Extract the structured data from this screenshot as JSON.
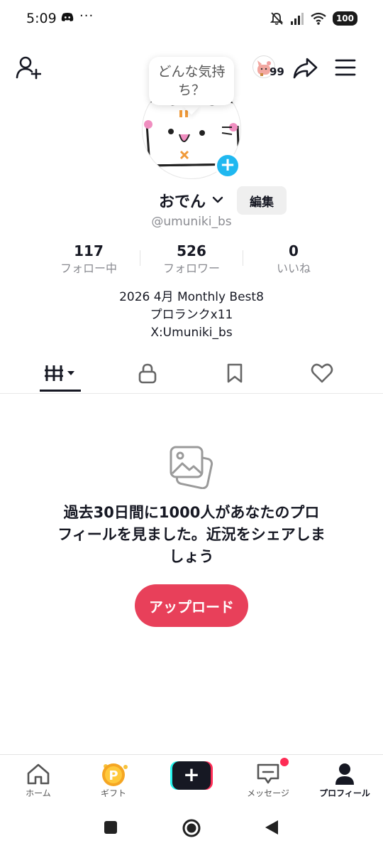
{
  "status_bar": {
    "time": "5:09",
    "dots": "···",
    "battery": "100"
  },
  "top_bar": {
    "bubble_text": "どんな気持ち？",
    "hearts_count": "99"
  },
  "profile": {
    "name": "おでん",
    "edit_label": "編集",
    "handle": "@umuniki_bs",
    "stats": [
      {
        "value": "117",
        "label": "フォロー中"
      },
      {
        "value": "526",
        "label": "フォロワー"
      },
      {
        "value": "0",
        "label": "いいね"
      }
    ],
    "bio": [
      "2026 4月 Monthly Best8",
      "プロランクx11",
      "X:Umuniki_bs"
    ]
  },
  "empty_state": {
    "message": "過去30日間に1000人があなたのプロフィールを見ました。近況をシェアしましょう",
    "upload_label": "アップロード"
  },
  "bottom_nav": {
    "home": "ホーム",
    "gift": "ギフト",
    "messages": "メッセージ",
    "profile": "プロフィール"
  },
  "colors": {
    "accent": "#e8405a",
    "plus_badge": "#20b8f0",
    "text_primary": "#161823",
    "text_secondary": "#8a8b91"
  }
}
